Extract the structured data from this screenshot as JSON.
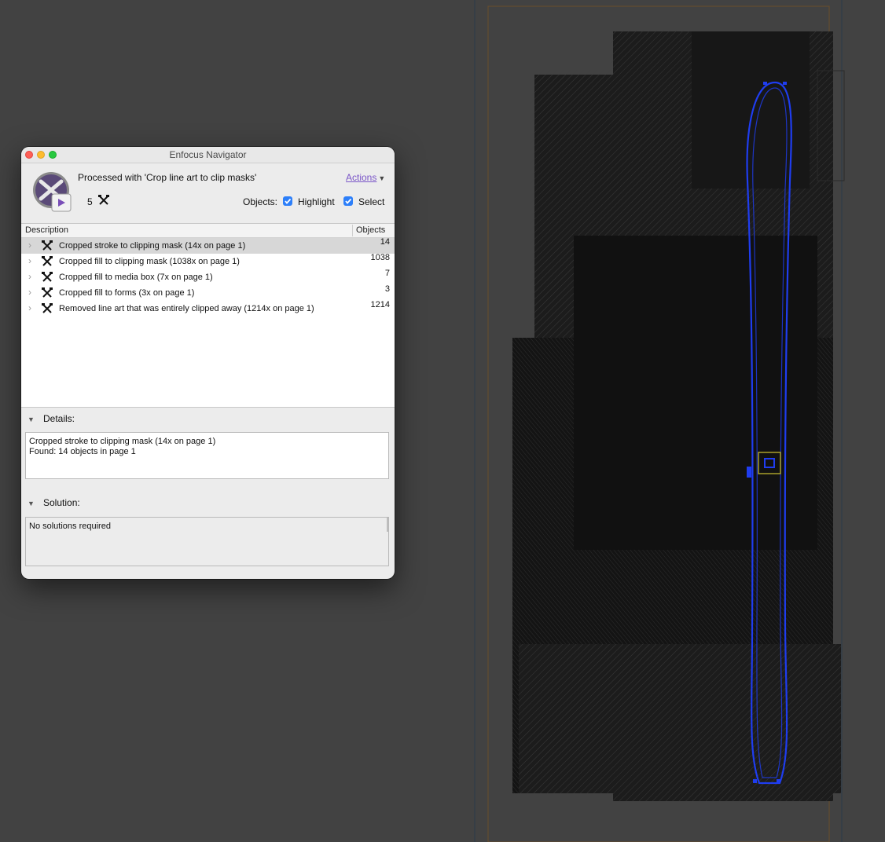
{
  "window": {
    "title": "Enfocus Navigator",
    "processed_text": "Processed with 'Crop line art to clip masks'",
    "actions_label": "Actions",
    "count": "5",
    "objects_label": "Objects:",
    "highlight_label": "Highlight",
    "select_label": "Select",
    "highlight_checked": true,
    "select_checked": true
  },
  "table": {
    "col_description": "Description",
    "col_objects": "Objects",
    "rows": [
      {
        "label": "Cropped stroke to clipping mask (14x on page 1)",
        "count": "14",
        "selected": true
      },
      {
        "label": "Cropped fill to clipping mask (1038x on page 1)",
        "count": "1038",
        "selected": false
      },
      {
        "label": "Cropped fill to media box (7x on page 1)",
        "count": "7",
        "selected": false
      },
      {
        "label": "Cropped fill to forms (3x on page 1)",
        "count": "3",
        "selected": false
      },
      {
        "label": "Removed line art that was entirely clipped away (1214x on page 1)",
        "count": "1214",
        "selected": false
      }
    ]
  },
  "details": {
    "heading": "Details:",
    "line1": "Cropped stroke to clipping mask (14x on page 1)",
    "line2": "Found: 14 objects in page 1"
  },
  "solution": {
    "heading": "Solution:",
    "text": "No solutions required"
  },
  "colors": {
    "canvas_bg": "#424242",
    "artwork_dark": "#121212",
    "selection_outline": "#1f3df0",
    "accent_checkbox": "#2d7ff9",
    "link_purple": "#7a55c8"
  },
  "icons": {
    "app": "enfocus-navigator-app-icon",
    "fix": "crossed-tools-icon",
    "disclosure": "chevron-right-icon",
    "section_toggle": "triangle-down-icon"
  }
}
